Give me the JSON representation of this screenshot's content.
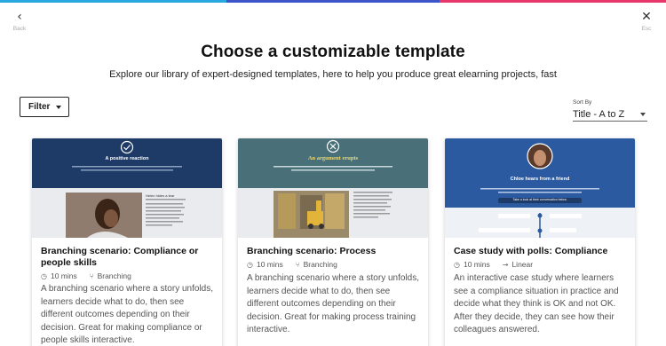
{
  "header": {
    "back_label": "Back",
    "close_label": "Esc",
    "title": "Choose a customizable template",
    "subtitle": "Explore our library of expert-designed templates, here to help you produce great elearning projects, fast"
  },
  "toolbar": {
    "filter_label": "Filter",
    "sort_label": "Sort By",
    "sort_value": "Title - A to Z"
  },
  "cards": [
    {
      "title": "Branching scenario: Compliance or people skills",
      "duration": "10 mins",
      "type": "Branching",
      "description": "A branching scenario where a story unfolds, learners decide what to do, then see different outcomes depending on their decision. Great for making compliance or people skills interactive.",
      "thumb": {
        "heading": "A positive reaction",
        "side_heading": "Helen hides a tear"
      }
    },
    {
      "title": "Branching scenario: Process",
      "duration": "10 mins",
      "type": "Branching",
      "description": "A branching scenario where a story unfolds, learners decide what to do, then see different outcomes depending on their decision. Great for making process training interactive.",
      "thumb": {
        "heading": "An argument erupts"
      }
    },
    {
      "title": "Case study with polls: Compliance",
      "duration": "10 mins",
      "type": "Linear",
      "description": "An interactive case study where learners see a compliance situation in practice and decide what they think is OK and not OK. After they decide, they can see how their colleagues answered.",
      "thumb": {
        "heading": "Chloe hears from a friend",
        "tag": "Take a look at their conversation below."
      }
    }
  ],
  "colors": {
    "navy": "#1e3a66",
    "teal": "#2f5c66",
    "blue": "#2c5aa0",
    "accent_cyan": "#29a8e0",
    "accent_blue": "#3b55c9",
    "accent_pink": "#e8356b"
  }
}
